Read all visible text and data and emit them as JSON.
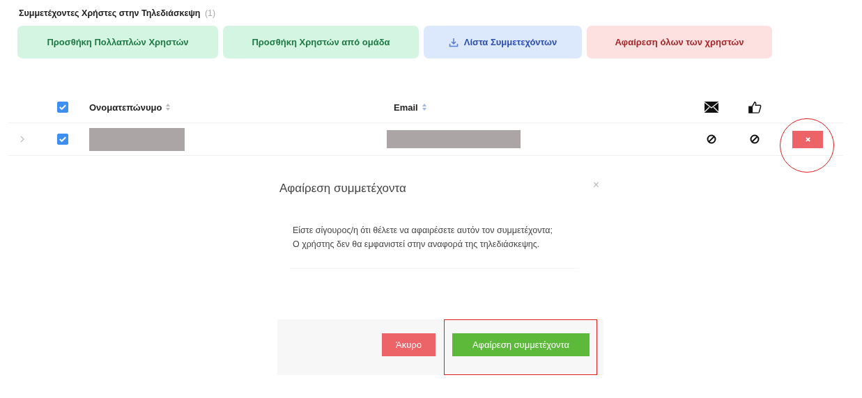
{
  "section": {
    "title": "Συμμετέχοντες Χρήστες στην Τηλεδιάσκεψη",
    "count": "(1)"
  },
  "actions": [
    {
      "label": "Προσθήκη Πολλαπλών Χρηστών",
      "kind": "success"
    },
    {
      "label": "Προσθήκη Χρηστών από ομάδα",
      "kind": "success"
    },
    {
      "label": "Λίστα Συμμετεχόντων",
      "kind": "download"
    },
    {
      "label": "Αφαίρεση όλων των χρηστών",
      "kind": "danger"
    }
  ],
  "table": {
    "select_all": {
      "checked": true
    },
    "columns": [
      {
        "label": "Ονοματεπώνυμο",
        "sortable": true
      },
      {
        "label": "Email",
        "sortable": true
      }
    ],
    "rows": [
      {
        "expanded": false,
        "checked": true,
        "mail_sent": false,
        "confirmed": false
      }
    ]
  },
  "modal": {
    "title": "Αφαίρεση συμμετέχοντα",
    "close": "×",
    "body": "Είστε σίγουρος/η ότι θέλετε να αφαιρέσετε αυτόν τον συμμετέχοντα; Ο χρήστης δεν θα εμφανιστεί στην αναφορά της τηλεδιάσκεψης.",
    "buttons": [
      {
        "label": "Άκυρο",
        "kind": "danger"
      },
      {
        "label": "Αφαίρεση συμμετέχοντα",
        "kind": "success"
      }
    ]
  }
}
